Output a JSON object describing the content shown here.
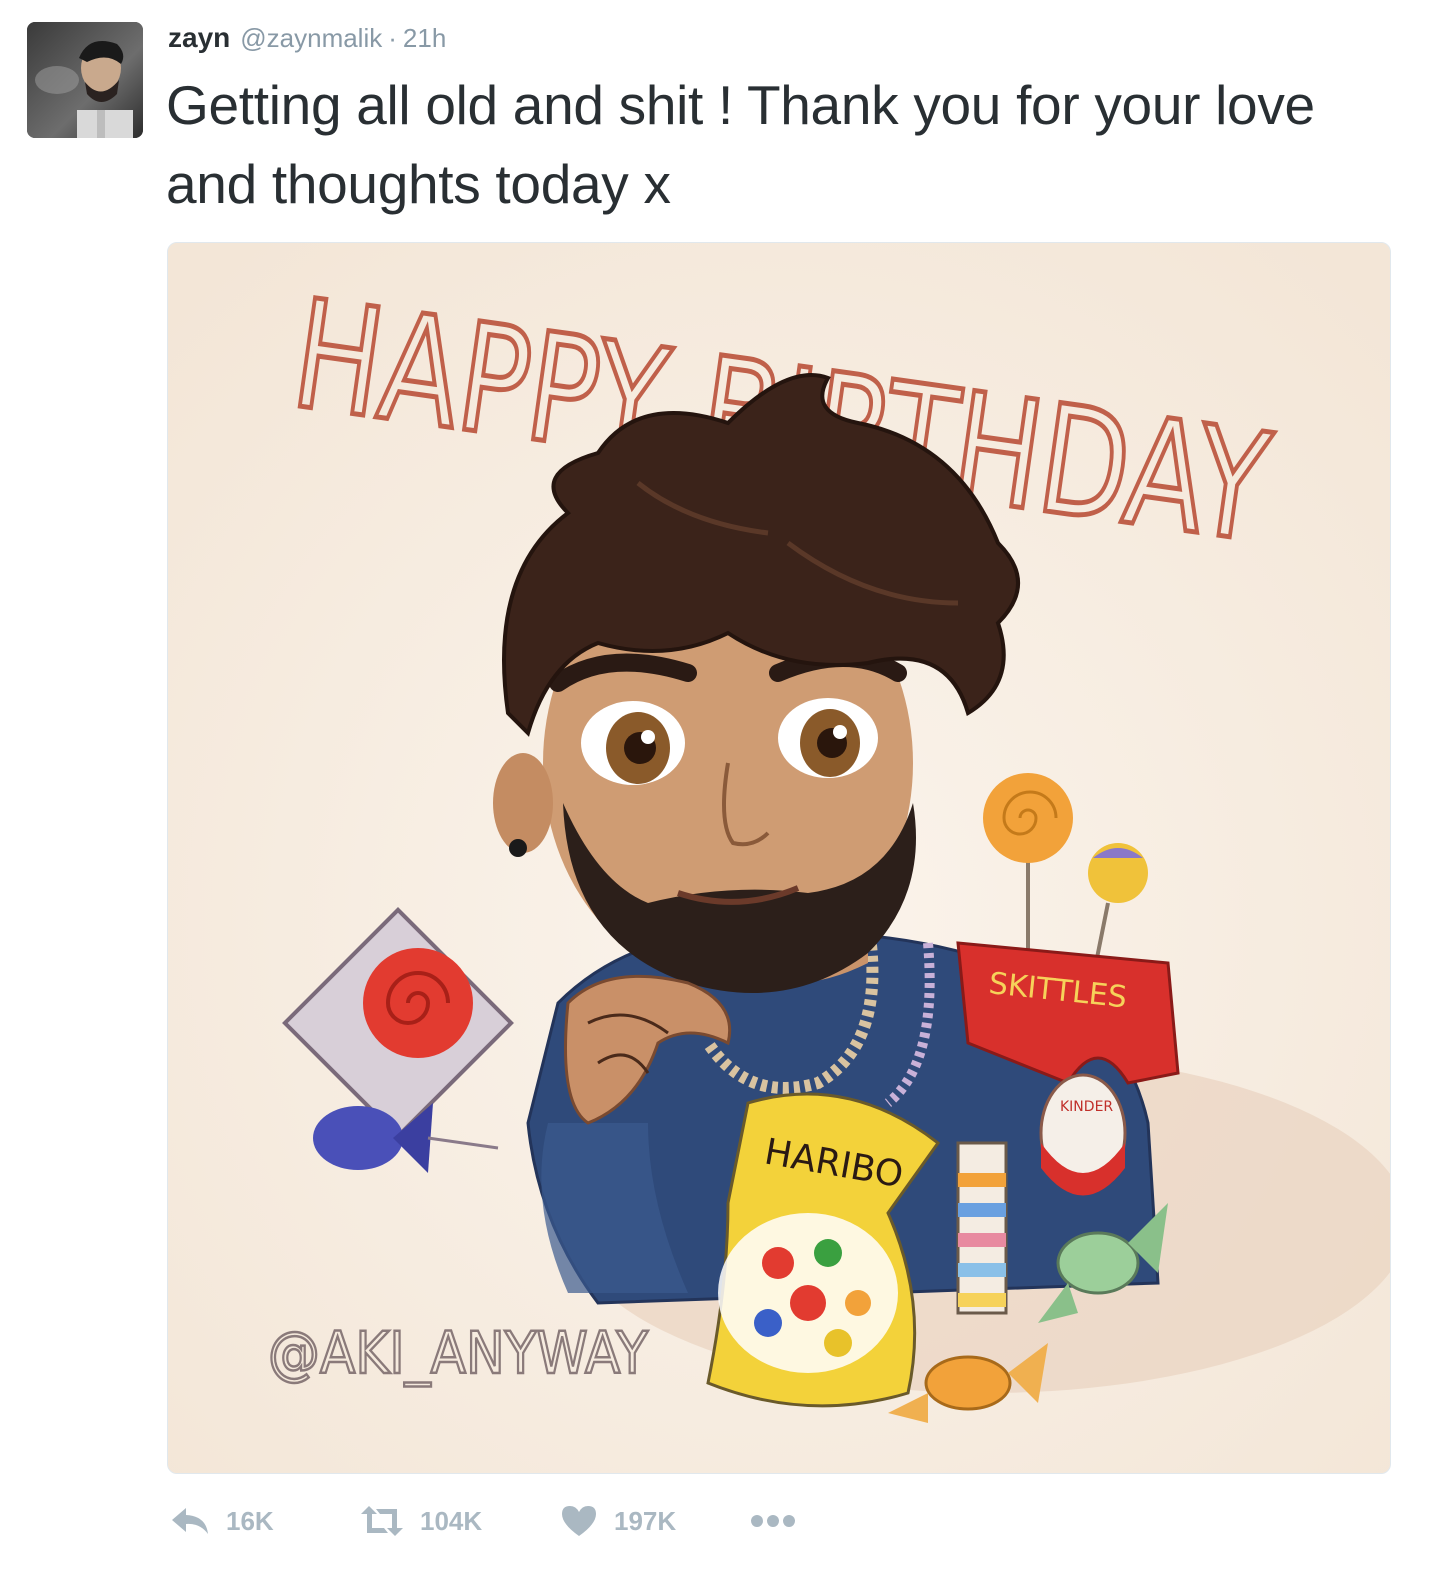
{
  "tweet": {
    "author_name": "zayn",
    "author_handle": "@zaynmalik",
    "separator": "·",
    "timestamp": "21h",
    "text": "Getting all old and shit ! Thank you for your love and thoughts today x",
    "avatar_icon": "user-avatar",
    "media": {
      "headline": "HAPPY BIRTHDAY",
      "signature": "@AKI_ANYWAY",
      "bag_label": "HARIBO",
      "box_label": "SKITTLES",
      "egg_label": "KINDER",
      "accent_color": "#c0604a",
      "background_color": "#f6ebdf"
    },
    "actions": {
      "reply": {
        "icon": "reply-icon",
        "count": "16K"
      },
      "retweet": {
        "icon": "retweet-icon",
        "count": "104K"
      },
      "like": {
        "icon": "heart-icon",
        "count": "197K"
      },
      "more": {
        "icon": "more-icon",
        "label": "•••"
      }
    }
  }
}
